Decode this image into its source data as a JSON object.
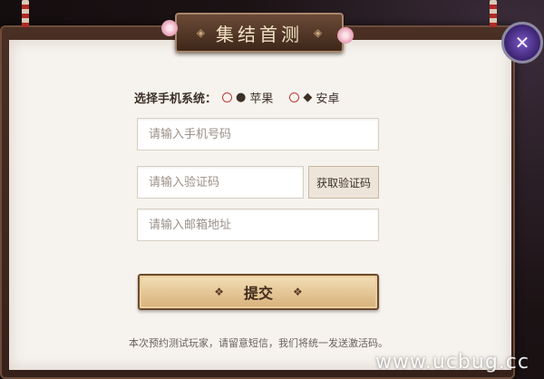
{
  "title": "集结首测",
  "os_select": {
    "label": "选择手机系统：",
    "options": [
      {
        "icon": "apple-icon",
        "label": "苹果"
      },
      {
        "icon": "android-icon",
        "label": "安卓"
      }
    ]
  },
  "form": {
    "phone_placeholder": "请输入手机号码",
    "code_placeholder": "请输入验证码",
    "code_button": "获取验证码",
    "email_placeholder": "请输入邮箱地址",
    "submit_label": "提交"
  },
  "note": "本次预约测试玩家，请留意短信，我们将统一发送激活码。",
  "watermark": "www.ucbug.cc",
  "colors": {
    "accent": "#c13a36",
    "frame": "#4a2f24",
    "paper": "#f6f3ee"
  }
}
